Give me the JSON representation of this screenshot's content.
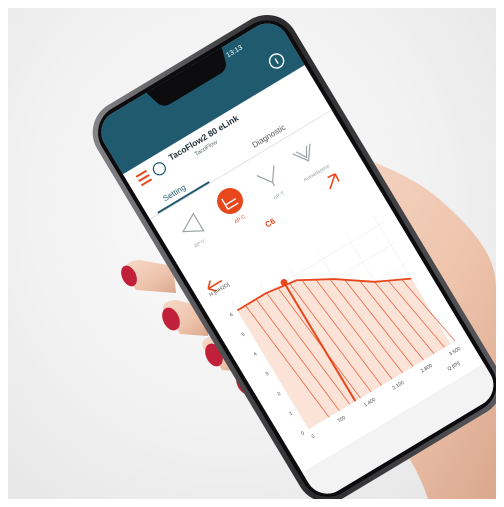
{
  "status_bar": {
    "time": "13:13"
  },
  "app": {
    "title": "TacoFlow2 80 eLink",
    "subtitle": "TacoFlow",
    "info_icon": "info-icon",
    "menu_icon": "hamburger-icon",
    "account_icon": "user-icon"
  },
  "tabs": [
    {
      "label": "Setting",
      "active": true
    },
    {
      "label": "Diagnostic",
      "active": false
    }
  ],
  "modes": [
    {
      "label": "ΔP-V",
      "icon": "delta-p-variable-icon",
      "state": "inactive"
    },
    {
      "label": "ΔP-C",
      "icon": "delta-p-constant-icon",
      "state": "active"
    },
    {
      "label": "ΔP-T",
      "icon": "delta-p-temperature-icon",
      "state": "inactive"
    },
    {
      "label": "Autoadaptive",
      "icon": "autoadaptive-icon",
      "state": "inactive"
    }
  ],
  "setpoint_label": "C6",
  "chart_data": {
    "type": "area",
    "ylabel": "H [mH2O]",
    "xlabel": "Q [l/h]",
    "y_ticks": [
      "0",
      "1",
      "2",
      "3",
      "4",
      "5",
      "6"
    ],
    "x_ticks": [
      "0",
      "700",
      "1.400",
      "2.100",
      "2.800",
      "3.500"
    ],
    "curve": {
      "x": [
        0,
        700,
        1400,
        2100,
        2800,
        3500
      ],
      "y": [
        6,
        6,
        5.8,
        5.0,
        4.0,
        3.3
      ]
    },
    "setpoint": {
      "x": 1150,
      "y": 6
    }
  },
  "colors": {
    "accent": "#e8471c",
    "header": "#1f5a6e",
    "fill": "#fbe3d7"
  }
}
